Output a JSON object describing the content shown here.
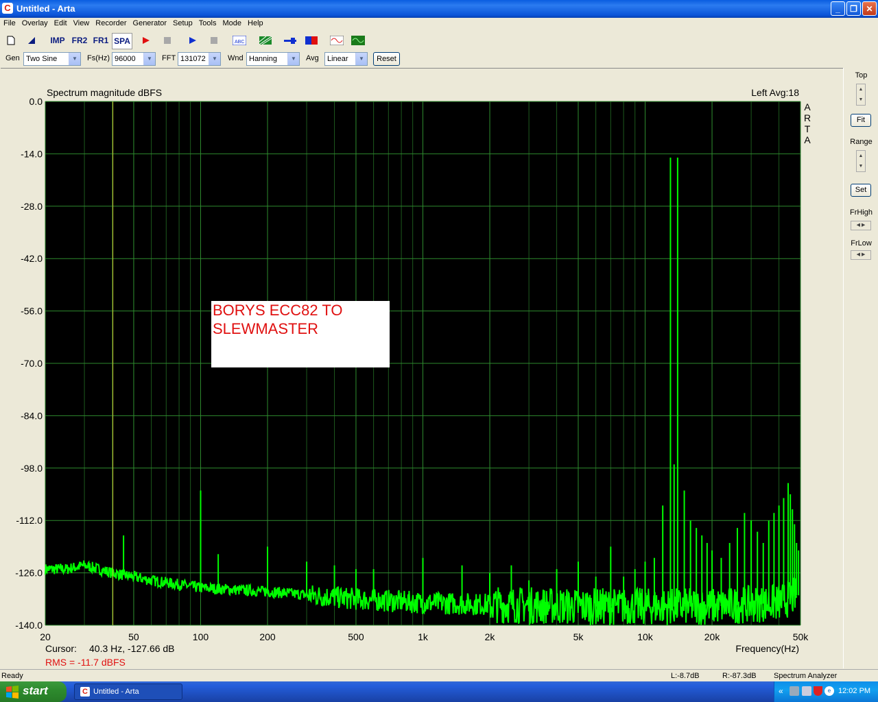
{
  "window": {
    "title": "Untitled - Arta",
    "app_icon": "C"
  },
  "menu": [
    "File",
    "Overlay",
    "Edit",
    "View",
    "Recorder",
    "Generator",
    "Setup",
    "Tools",
    "Mode",
    "Help"
  ],
  "toolbar": {
    "imp": "IMP",
    "fr2": "FR2",
    "fr1": "FR1",
    "spa": "SPA"
  },
  "controls": {
    "gen_label": "Gen",
    "gen_value": "Two Sine",
    "fs_label": "Fs(Hz)",
    "fs_value": "96000",
    "fft_label": "FFT",
    "fft_value": "131072",
    "wnd_label": "Wnd",
    "wnd_value": "Hanning",
    "avg_label": "Avg",
    "avg_value": "Linear",
    "reset_label": "Reset"
  },
  "side": {
    "top_label": "Top",
    "fit_label": "Fit",
    "range_label": "Range",
    "set_label": "Set",
    "frhigh_label": "FrHigh",
    "frlow_label": "FrLow"
  },
  "plot": {
    "title": "Spectrum magnitude dBFS",
    "channel": "Left  Avg:18",
    "arta_letters": [
      "A",
      "R",
      "T",
      "A"
    ],
    "x_axis_label": "Frequency(Hz)",
    "cursor_label": "Cursor:",
    "cursor_value": "40.3 Hz, -127.66 dB",
    "rms": "RMS =  -11.7 dBFS",
    "annotation": "BORYS ECC82 TO\nSLEWMASTER"
  },
  "chart_data": {
    "type": "line",
    "title": "Spectrum magnitude dBFS",
    "xlabel": "Frequency(Hz)",
    "ylabel": "",
    "x_scale": "log",
    "xlim": [
      20,
      50000
    ],
    "ylim": [
      -140,
      0
    ],
    "x_ticks": [
      20,
      50,
      100,
      200,
      500,
      1000,
      2000,
      5000,
      10000,
      20000,
      50000
    ],
    "x_tick_labels": [
      "20",
      "50",
      "100",
      "200",
      "500",
      "1k",
      "2k",
      "5k",
      "10k",
      "20k",
      "50k"
    ],
    "y_ticks": [
      0,
      -14,
      -28,
      -42,
      -56,
      -70,
      -84,
      -98,
      -112,
      -126,
      -140
    ],
    "y_tick_labels": [
      "0.0",
      "-14.0",
      "-28.0",
      "-42.0",
      "-56.0",
      "-70.0",
      "-84.0",
      "-98.0",
      "-112.0",
      "-126.0",
      "-140.0"
    ],
    "cursor_hz": 40.3,
    "grid": true,
    "series": [
      {
        "color": "#00ff00",
        "floor": [
          [
            20,
            -125
          ],
          [
            25,
            -125
          ],
          [
            30,
            -124
          ],
          [
            40,
            -126
          ],
          [
            60,
            -128
          ],
          [
            100,
            -130
          ],
          [
            200,
            -131
          ],
          [
            500,
            -133
          ],
          [
            1000,
            -134
          ],
          [
            5000,
            -135
          ],
          [
            20000,
            -135
          ],
          [
            40000,
            -134
          ],
          [
            48000,
            -132
          ]
        ],
        "peaks": [
          [
            45,
            -116
          ],
          [
            100,
            -104
          ],
          [
            120,
            -121
          ],
          [
            200,
            -119
          ],
          [
            300,
            -123
          ],
          [
            400,
            -124
          ],
          [
            500,
            -125
          ],
          [
            600,
            -125
          ],
          [
            1000,
            -122
          ],
          [
            1500,
            -124
          ],
          [
            2000,
            -126
          ],
          [
            2500,
            -124
          ],
          [
            3000,
            -128
          ],
          [
            4000,
            -125
          ],
          [
            5000,
            -123
          ],
          [
            6000,
            -127
          ],
          [
            7000,
            -119
          ],
          [
            8000,
            -127
          ],
          [
            9000,
            -125
          ],
          [
            10000,
            -123
          ],
          [
            11000,
            -122
          ],
          [
            12000,
            -108
          ],
          [
            13000,
            -15
          ],
          [
            13500,
            -97
          ],
          [
            14000,
            -15
          ],
          [
            15000,
            -104
          ],
          [
            16000,
            -112
          ],
          [
            17000,
            -114
          ],
          [
            18000,
            -116
          ],
          [
            19000,
            -118
          ],
          [
            20000,
            -120
          ],
          [
            22000,
            -122
          ],
          [
            24000,
            -118
          ],
          [
            26000,
            -114
          ],
          [
            28000,
            -110
          ],
          [
            30000,
            -112
          ],
          [
            32000,
            -115
          ],
          [
            34000,
            -118
          ],
          [
            36000,
            -112
          ],
          [
            38000,
            -110
          ],
          [
            40000,
            -108
          ],
          [
            42000,
            -106
          ],
          [
            44000,
            -102
          ],
          [
            45000,
            -105
          ],
          [
            46000,
            -109
          ],
          [
            47000,
            -113
          ],
          [
            48000,
            -118
          ],
          [
            49000,
            -120
          ]
        ],
        "line_width": 2
      }
    ],
    "cursor_color": "#cccc33"
  },
  "status": {
    "ready": "Ready",
    "left_level": "L:-8.7dB",
    "right_level": "R:-87.3dB",
    "mode": "Spectrum Analyzer"
  },
  "taskbar": {
    "start": "start",
    "task": "Untitled - Arta",
    "clock": "12:02 PM"
  }
}
